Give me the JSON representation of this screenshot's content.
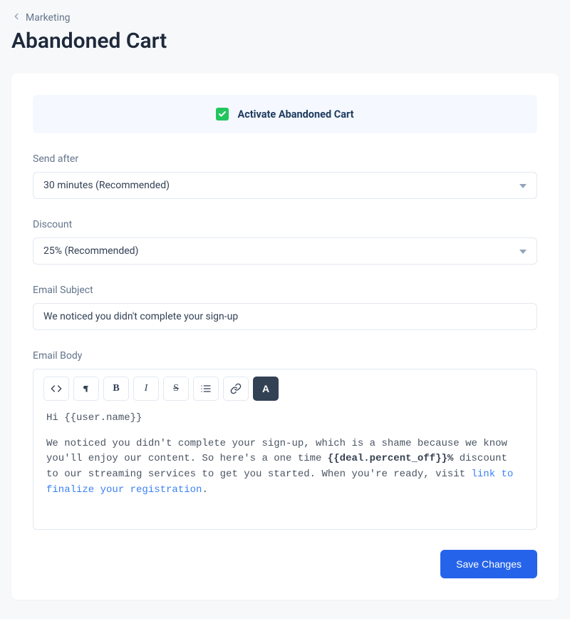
{
  "breadcrumb": {
    "label": "Marketing"
  },
  "page": {
    "title": "Abandoned Cart"
  },
  "activate": {
    "label": "Activate Abandoned Cart",
    "checked": true
  },
  "form": {
    "send_after": {
      "label": "Send after",
      "value": "30 minutes (Recommended)"
    },
    "discount": {
      "label": "Discount",
      "value": "25% (Recommended)"
    },
    "subject": {
      "label": "Email Subject",
      "value": "We noticed you didn't complete your sign-up"
    },
    "body_label": "Email Body",
    "body": {
      "greeting": "Hi {{user.name}}",
      "p1_a": "We noticed you didn't complete your sign-up, which is a shame because we know you'll enjoy our content. So here's a one time ",
      "p1_bold": "{{deal.percent_off}}%",
      "p1_b": " discount to our streaming services to get you started. When you're ready, visit ",
      "link_text": "link to finalize your registration",
      "p1_end": "."
    }
  },
  "actions": {
    "save": "Save Changes"
  },
  "toolbar": {
    "bold": "B",
    "italic": "I",
    "strike": "S",
    "text_style": "A"
  }
}
